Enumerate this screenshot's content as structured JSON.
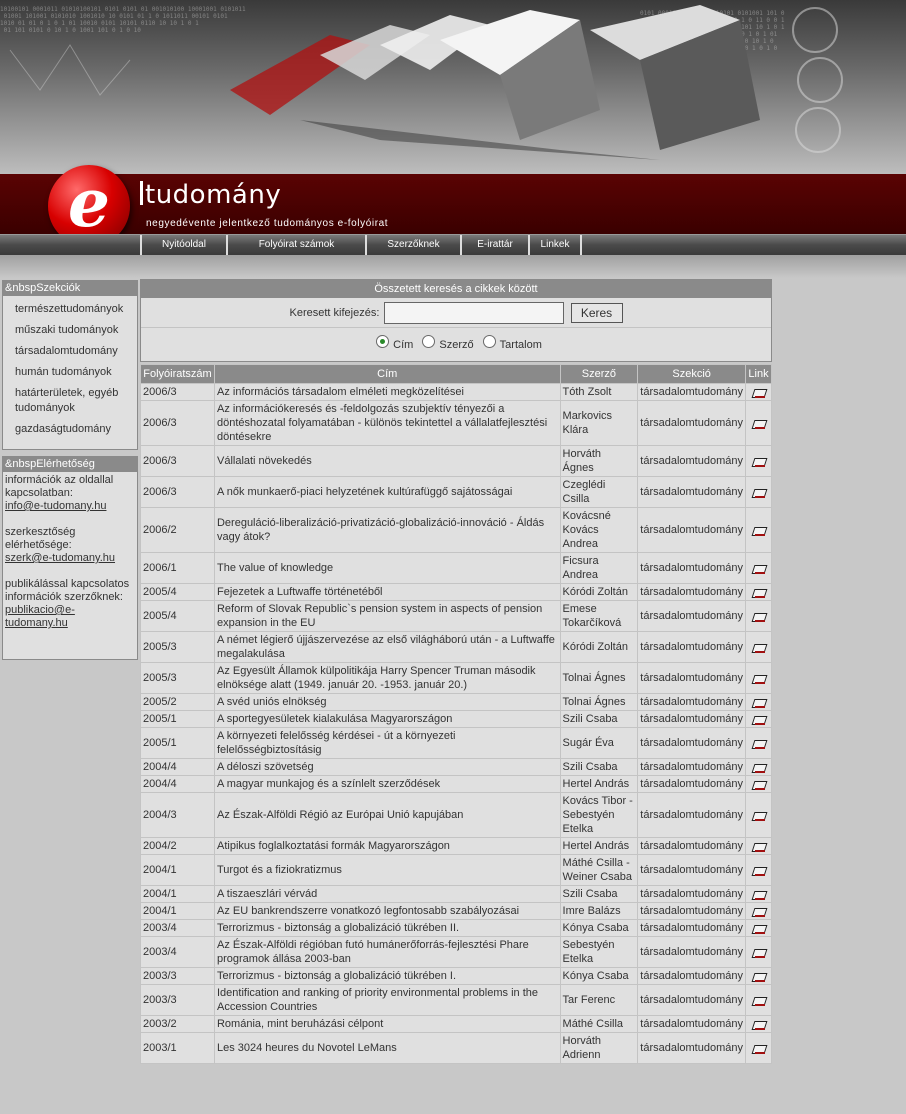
{
  "header": {
    "logo_letter": "e",
    "title": "tudomány",
    "subtitle": "negyedévente jelentkező tudományos e-folyóirat"
  },
  "nav": [
    "Nyitóoldal",
    "Folyóirat számok",
    "Szerzőknek",
    "E-irattár",
    "Linkek"
  ],
  "sections_panel": {
    "heading": "&nbspSzekciók",
    "items": [
      "természettudományok",
      "műszaki tudományok",
      "társadalomtudomány",
      "humán tudományok",
      "határterületek, egyéb tudományok",
      "gazdaságtudomány"
    ]
  },
  "contact_panel": {
    "heading": "&nbspElérhetőség",
    "groups": [
      {
        "text": "információk az oldallal kapcsolatban:",
        "email": "info@e-tudomany.hu"
      },
      {
        "text": "szerkesztőség elérhetősége:",
        "email": "szerk@e-tudomany.hu"
      },
      {
        "text": "publikálással kapcsolatos információk szerzőknek:",
        "email": "publikacio@e-tudomany.hu"
      }
    ]
  },
  "search": {
    "heading": "Összetett keresés a cikkek között",
    "label": "Keresett kifejezés:",
    "value": "",
    "button": "Keres",
    "options": [
      {
        "label": "Cím",
        "selected": true
      },
      {
        "label": "Szerző",
        "selected": false
      },
      {
        "label": "Tartalom",
        "selected": false
      }
    ]
  },
  "table": {
    "headers": [
      "Folyóiratszám",
      "Cím",
      "Szerző",
      "Szekció",
      "Link"
    ],
    "rows": [
      {
        "issue": "2006/3",
        "title": "Az információs társadalom elméleti megközelítései",
        "author": "Tóth Zsolt",
        "section": "társadalomtudomány"
      },
      {
        "issue": "2006/3",
        "title": "Az információkeresés és -feldolgozás szubjektív tényezői a döntéshozatal folyamatában - különös tekintettel a vállalatfejlesztési döntésekre",
        "author": "Markovics Klára",
        "section": "társadalomtudomány"
      },
      {
        "issue": "2006/3",
        "title": "Vállalati növekedés",
        "author": "Horváth Ágnes",
        "section": "társadalomtudomány"
      },
      {
        "issue": "2006/3",
        "title": "A nők munkaerő-piaci helyzetének kultúrafüggő sajátosságai",
        "author": "Czeglédi Csilla",
        "section": "társadalomtudomány"
      },
      {
        "issue": "2006/2",
        "title": "Dereguláció-liberalizáció-privatizáció-globalizáció-innováció - Áldás vagy átok?",
        "author": "Kovácsné Kovács Andrea",
        "section": "társadalomtudomány"
      },
      {
        "issue": "2006/1",
        "title": "The value of knowledge",
        "author": "Ficsura Andrea",
        "section": "társadalomtudomány"
      },
      {
        "issue": "2005/4",
        "title": "Fejezetek a Luftwaffe történetéből",
        "author": "Kóródi Zoltán",
        "section": "társadalomtudomány"
      },
      {
        "issue": "2005/4",
        "title": "Reform of Slovak Republic`s pension system in aspects of pension expansion in the EU",
        "author": "Emese Tokarčíková",
        "section": "társadalomtudomány"
      },
      {
        "issue": "2005/3",
        "title": "A német légierő újjászervezése az első világháború után - a Luftwaffe megalakulása",
        "author": "Kóródi Zoltán",
        "section": "társadalomtudomány"
      },
      {
        "issue": "2005/3",
        "title": "Az Egyesült Államok külpolitikája Harry Spencer Truman második elnöksége alatt (1949. január 20. -1953. január 20.)",
        "author": "Tolnai Ágnes",
        "section": "társadalomtudomány"
      },
      {
        "issue": "2005/2",
        "title": "A svéd uniós elnökség",
        "author": "Tolnai Ágnes",
        "section": "társadalomtudomány"
      },
      {
        "issue": "2005/1",
        "title": "A sportegyesületek kialakulása Magyarországon",
        "author": "Szili Csaba",
        "section": "társadalomtudomány"
      },
      {
        "issue": "2005/1",
        "title": "A környezeti felelősség kérdései - út a környezeti felelősségbiztosításig",
        "author": "Sugár Éva",
        "section": "társadalomtudomány"
      },
      {
        "issue": "2004/4",
        "title": "A déloszi szövetség",
        "author": "Szili Csaba",
        "section": "társadalomtudomány"
      },
      {
        "issue": "2004/4",
        "title": "A magyar munkajog és a színlelt szerződések",
        "author": "Hertel András",
        "section": "társadalomtudomány"
      },
      {
        "issue": "2004/3",
        "title": "Az Észak-Alföldi Régió az Európai Unió kapujában",
        "author": "Kovács Tibor - Sebestyén Etelka",
        "section": "társadalomtudomány"
      },
      {
        "issue": "2004/2",
        "title": "Atipikus foglalkoztatási formák Magyarországon",
        "author": "Hertel András",
        "section": "társadalomtudomány"
      },
      {
        "issue": "2004/1",
        "title": "Turgot és a fiziokratizmus",
        "author": "Máthé Csilla - Weiner Csaba",
        "section": "társadalomtudomány"
      },
      {
        "issue": "2004/1",
        "title": "A tiszaeszlári vérvád",
        "author": "Szili Csaba",
        "section": "társadalomtudomány"
      },
      {
        "issue": "2004/1",
        "title": "Az EU bankrendszerre vonatkozó legfontosabb szabályozásai",
        "author": "Imre Balázs",
        "section": "társadalomtudomány"
      },
      {
        "issue": "2003/4",
        "title": "Terrorizmus - biztonság a globalizáció tükrében II.",
        "author": "Kónya Csaba",
        "section": "társadalomtudomány"
      },
      {
        "issue": "2003/4",
        "title": "Az Észak-Alföldi régióban futó humánerőforrás-fejlesztési Phare programok állása 2003-ban",
        "author": "Sebestyén Etelka",
        "section": "társadalomtudomány"
      },
      {
        "issue": "2003/3",
        "title": "Terrorizmus - biztonság a globalizáció tükrében I.",
        "author": "Kónya Csaba",
        "section": "társadalomtudomány"
      },
      {
        "issue": "2003/3",
        "title": "Identification and ranking of priority environmental problems in the Accession Countries",
        "author": "Tar Ferenc",
        "section": "társadalomtudomány"
      },
      {
        "issue": "2003/2",
        "title": "Románia, mint beruházási célpont",
        "author": "Máthé Csilla",
        "section": "társadalomtudomány"
      },
      {
        "issue": "2003/1",
        "title": "Les 3024 heures du Novotel LeMans",
        "author": "Horváth Adrienn",
        "section": "társadalomtudomány"
      }
    ]
  }
}
